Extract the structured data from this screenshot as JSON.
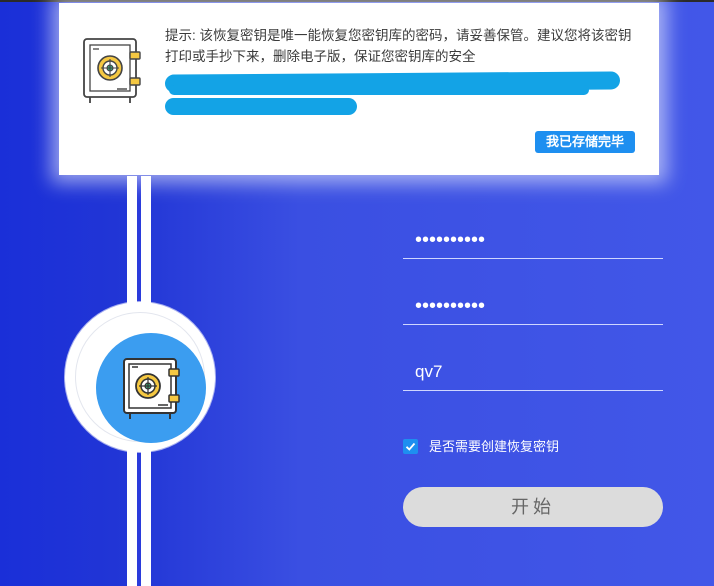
{
  "notice": {
    "text": "提示: 该恢复密钥是唯一能恢复您密钥库的密码，请妥善保管。建议您将该密钥打印或手抄下来，删除电子版，保证您密钥库的安全",
    "confirm_label": "我已存储完毕",
    "icon": "safe-icon"
  },
  "form": {
    "password": "••••••••••",
    "confirm_password": "••••••••••",
    "hint_value": "qv7",
    "checkbox_checked": true,
    "checkbox_label": "是否需要创建恢复密钥",
    "start_label": "开始"
  },
  "badge": {
    "icon": "safe-icon"
  },
  "colors": {
    "background_left": "#1a2fd8",
    "background_right": "#4257e8",
    "accent": "#1e8ff0",
    "badge": "#3b9df0",
    "redaction": "#13a3e6",
    "start_button": "#dcdcdc"
  }
}
